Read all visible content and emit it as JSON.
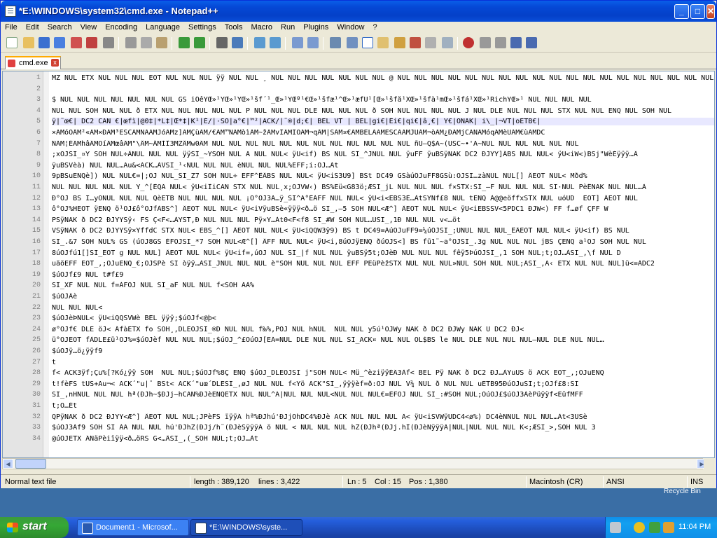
{
  "window": {
    "title": "*E:\\WINDOWS\\system32\\cmd.exe - Notepad++",
    "minimize": "_",
    "maximize": "□",
    "close": "✕"
  },
  "menu": [
    "File",
    "Edit",
    "Search",
    "View",
    "Encoding",
    "Language",
    "Settings",
    "Tools",
    "Macro",
    "Run",
    "Plugins",
    "Window",
    "?"
  ],
  "tab": {
    "label": "cmd.exe",
    "close": "x"
  },
  "editor": {
    "current_line": 5,
    "lines": [
      {
        "n": "1",
        "t": "MZ NUL ETX NUL NUL NUL EOT NUL NUL NUL ÿÿ NUL NUL ¸ NUL NUL NUL NUL NUL NUL NUL @ NUL NUL NUL NUL NUL NUL NUL NUL NUL NUL NUL NUL NUL NUL NUL NUL NUL NUL NUL NUL NUL NUL NUL"
      },
      {
        "n": "2",
        "t": ""
      },
      {
        "n": "3",
        "t": "$ NUL NUL NUL NUL NUL NUL NUL GS iÕêYŒ»¹YŒ»¹YŒ»¹šf´¹_Œ»¹YŒº¹€Œ»¹šfæ¹^Œ»¹æfÛ¹[Œ»¹šfå¹XŒ»¹šfà¹mŒ»¹šfá¹XŒ»¹RichYŒ»¹ NUL NUL NUL NUL"
      },
      {
        "n": "4",
        "t": "NUL NUL SOH NUL NUL ð ETX NUL NUL NUL NUL NUL P NUL NUL NUL DLE NUL NUL NUL ð SOH NUL NUL NUL NUL J NUL DLE NUL NUL NUL STX NUL NUL ENQ NUL SOH NUL"
      },
      {
        "n": "5",
        "t": "ÿ|¨œ€| DC2 CAN €|œfì|@0‡|*L‡|Œ*‡|K¹|É/|·SO|a°€|™²|ACK/|¨®|d;€| BEL VT | BEL|gi€|Êi€|qi€|â¸€| Y€|ÒNAK| i\\_|¬VT|oETB€|"
      },
      {
        "n": "6",
        "t": "×ÄMóÔÂM²«ÄM×ÐÀM³ESCÃMNÃÃMJóÃMz]ÃMÇùÃM/€ÃM™ÑÃMòìÃM~žÃMvÌÃMÏÔÃM¬qÂM|SÃM¤€ÃMBELÃÃMESCÃÃMJÜÃM¬òÃM¿ÐÃMjCANÃMóqÃMèÙÃM€ùÃMDC"
      },
      {
        "n": "7",
        "t": "ÑÃM¦ÉÃMhâÃMOíÃMœâÃM\"\\ÂM~ÂMÍÎ3MZÂMw0ÃM NUL NUL NUL NUL NUL NUL NUL NUL NUL NUL NUL NUL ñÙ–Q$Ä~(USC~•'Ä~NUL NUL NUL NUL NUL NUL"
      },
      {
        "n": "8",
        "t": ";xÓJSI_¤Ÿ SOH NUL÷ÂNUL NUL NUL ÿÿSI_~ŸSOH NUL Ã NUL NUL< ÿU<if) BS NUL SI_^JNUL NUL ÿuFF ÿuBSÿNAK DC2 ÐJYY]ÂBS NUL NUL< ÿU<iW<)BSj\"WèÉÿÿÿ…Â"
      },
      {
        "n": "9",
        "t": "ÿuBSVèà) NUL NUL…Äu&<ACK…ÀVSI_¹‹NUL NUL NUL èNUL NUL NUL%EFF;i:ÓJ…Àt"
      },
      {
        "n": "10",
        "t": "9pBSuENQè]) NUL NUL€=|;ÓJ NUL_SI_Z7 SOH NUL÷ EFF^ÊÂBS NUL NUL< ÿU<iS3Ü9] BSt DC49 GSàúÕJuFF8GSù:ÓJSI…zàNUL NUL[] ÂEOT NUL< Mðd%"
      },
      {
        "n": "11",
        "t": "NUL NUL NUL NUL NUL Y_^[ÉQÃ NUL< ÿU<iÎiCAN STX NUL NUL¸x;ÓJVW‹) BS%Eü<G83ö;ÆSI_jL NUL NUL NUL f×STX:SI_–F NUL NUL NUL SI·NUL PèÊNAK NUL NUL…À"
      },
      {
        "n": "12",
        "t": "Ð°ÓJ BS I…yÔNUL NUL NUL QèETB NUL NUL NUL NUL ¡Ô°ÓJ3Ä…ÿ_SI^Ä°ÉÁFF NUL NUL< ÿU<i<EBS3È…ÀtSYNf£8 NUL tENQ À@@eöffxSTX NUL uóÛD  EOT] ÂEOT NUL"
      },
      {
        "n": "13",
        "t": "ô°ÓJ%HEOT ÿENQ ö¹ÓJ£ô°ÓJfÀBS^] ÂEOT NUL NUL< ÿU<iVÿuBSè«ÿÿÿ<ð…ö SI_,–5 SOH NUL<Æ^] ÂEOT NUL NUL< ÿU<iEBSSV<5PDC1 ÐJW<) FF f…øf ÇFF W"
      },
      {
        "n": "14",
        "t": "PSÿNAK ð DC2 ÐJYYSÿ‹ FS Ç<F<…ÀYST,Ð NUL NUL NUL Pÿ×Y…Àt0<F<f8 SI_#W SOH NUL…ÜSI_,1Ð NUL NUL v<…öt"
      },
      {
        "n": "15",
        "t": "VSÿNAK ð DC2 ÐJYYSÿ×YffdC STX NUL< EBS_^[] ÂEOT NUL NUL< ÿU<iQQW3ÿ9) BS t DC49=ÀúÓJuFF9=¼úÓJSI_;ÙNUL NUL NUL_ÊÂEOT NUL NUL< ÿU<if) BS NUL"
      },
      {
        "n": "16",
        "t": "SI_.&7 SOH NUL% GS (úÓJ8GS ÈFÓJSI_*7 SOH NUL<Æ^[] ÂFF NUL NUL< ÿU<i,8úÓJÿENQ ðúÓJS<] BS fü1¨~a°ÓJSI_.3g NUL NUL NUL jBS ÇENQ a¹ÓJ SOH NUL NUL"
      },
      {
        "n": "17",
        "t": "8úÓJfú1[]SI_EOT g NUL NUL] ÂEOT NUL NUL< ÿU<if=,úÓJ NUL SI_|f NUL NUL ÿuBSÿ5t;ÓJèÐ NUL NUL NUL fêÿ5ÞúÓJSI_,1 SOH NUL;t;ÓJ…ÀSI_,\\f NUL D"
      },
      {
        "n": "18",
        "t": "uäöEFF EOT_,;ÓJuENQ_€;ÓJSPè SI òÿÿ…ÀSI_JNUL NUL NUL è\"SOH NUL NUL NUL EFF PEüPèžSTX NUL NUL NUL»NUL SOH NUL NUL;ÃSI_,Ä‹ ETX NUL NUL NUL]ü<=ÀDC2"
      },
      {
        "n": "19",
        "t": "$úÓJf£9 NUL t#f£9"
      },
      {
        "n": "20",
        "t": "SI_XF NUL NUL f=ÀFÓJ NUL SI_aF NUL NUL f<SOH ÃÀ%"
      },
      {
        "n": "21",
        "t": "$úÓJÂè"
      },
      {
        "n": "22",
        "t": "NUL NUL NUL<"
      },
      {
        "n": "23",
        "t": "$úÓJèÞNUL< ÿU<iQQSVWè BEL ÿÿÿ;$úÓJf<@þ<"
      },
      {
        "n": "24",
        "t": "ø°ÓJf€ DLE öJ< ÂfàETX fo SOH¸,DLEÔJSI_®D NUL NUL f‰%,PÓJ NUL hNUL  NUL NUL y5ú¹ÓJWy NAK ð DC2 ÐJWy NAK Ú DC2 ÐJ<"
      },
      {
        "n": "25",
        "t": "ü°ÓJEOT fÀDLE£ü¹ÓJ%=$úÓJèf NUL NUL NUL;$úÓJ_^£ÓúÓJ[EÃ=NUL DLE NUL NUL SI_ACK¤ NUL NUL ÓL$BS le NUL DLE NUL NUL NUL–NUL DLE NUL NUL…"
      },
      {
        "n": "26",
        "t": "$úÓJÿ…ö¿ÿÿf9"
      },
      {
        "n": "27",
        "t": "t"
      },
      {
        "n": "28",
        "t": "f< ACK3ÿf;Çu%[?Kó¿ÿÿ SOH  NUL NUL;$úÓJf%8Ç ENQ $úÓJ_DLEÓJSI j\"SOH NUL< Mü_^èziÿÿÉÃ3Àf< BEL Pÿ NAK ð DC2 ÐJ…ÀYuUS ö ACK EOT_,;ÓJuENQ"
      },
      {
        "n": "29",
        "t": "t!fèFS tUS+Äu¬< ACK´\"u|¨ BSt< ACK´\"uœ´DLESI_,øJ NUL NUL f<Ÿö ACK\"SI_,ÿÿÿèf=ð:ÓJ NUL V¾ NUL ð NUL NUL uETB95ÐúÓJuSI;t;ÓJf£8:SI"
      },
      {
        "n": "30",
        "t": "SI_,nHNUL NUL NUL hª(ÐJh~$ÐJj–hCAN%ÐJèENQETX NUL NUL^Ä|NUL NUL NUL<NUL NUL NUL€=ÈFÓJ NUL SI_:#SOH NUL;ÓúÓJ£$úÓJ3ÀèPüÿÿf<EüfMFF"
      },
      {
        "n": "31",
        "t": "t;Ó…Ét"
      },
      {
        "n": "32",
        "t": "QPÿNAK ð DC2 ÐJYY<Æ^] ÂEOT NUL NUL;JPèFS ïÿÿÃ hª%ÐJhú'ÐJjOhDC4%ÐJè ACK NUL NUL NUL Ã< ÿU<iSVWÿUDC4<ø%) DC4èNNUL NUL NUL…Àt<3ÛSè"
      },
      {
        "n": "33",
        "t": "$úÓJ3Àf9 SOH SI ÀÄ NUL NUL hú'ÐJhZ(ÐJj/h¨(ÐJèSÿÿÿÃ ö NUL < NUL NUL NUL hZ(ÐJhª(ÐJj.hÎ(ÐJèNÿÿÿÃ|NUL|NUL NUL NUL K<;ÆSI_>,SOH NUL 3"
      },
      {
        "n": "34",
        "t": "@úÓJETX ÃÑäPèiïÿÿ<ð…öRS G<…ÂSI_,(_SOH NUL;t;ÓJ…Àt"
      }
    ]
  },
  "status": {
    "filetype": "Normal text file",
    "length": "length : 389,120",
    "lines": "lines : 3,422",
    "ln": "Ln : 5",
    "col": "Col : 15",
    "pos": "Pos : 1,380",
    "eol": "Macintosh (CR)",
    "encoding": "ANSI",
    "mode": "INS"
  },
  "desktop": {
    "recycle_bin": "Recycle Bin"
  },
  "taskbar": {
    "start": "start",
    "tasks": [
      "Document1 - Microsof...",
      "*E:\\WINDOWS\\syste..."
    ],
    "clock": "11:04 PM"
  }
}
